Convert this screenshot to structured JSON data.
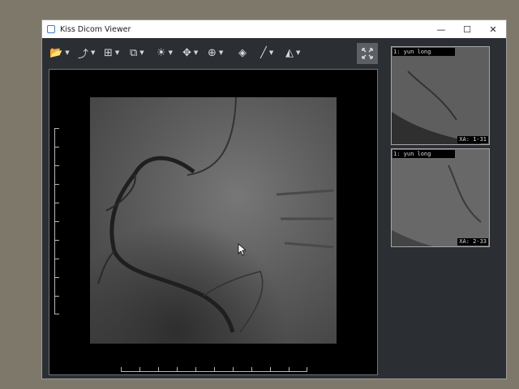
{
  "window": {
    "title": "Kiss Dicom Viewer",
    "controls": {
      "minimize": "—",
      "maximize": "☐",
      "close": "✕"
    }
  },
  "toolbar": {
    "tools": [
      {
        "name": "open-tool",
        "icon": "folder-icon",
        "glyph": "📂",
        "dropdown": true
      },
      {
        "name": "export-tool",
        "icon": "export-icon",
        "glyph": "⤴",
        "dropdown": true
      },
      {
        "name": "layout-tool",
        "icon": "grid-layout-icon",
        "glyph": "⊞",
        "dropdown": true
      },
      {
        "name": "annotation-tool",
        "icon": "text-overlay-icon",
        "glyph": "⧉",
        "dropdown": true
      },
      {
        "name": "brightness-tool",
        "icon": "brightness-icon",
        "glyph": "☀",
        "dropdown": true
      },
      {
        "name": "pan-tool",
        "icon": "move-icon",
        "glyph": "✥",
        "dropdown": true
      },
      {
        "name": "zoom-tool",
        "icon": "zoom-icon",
        "glyph": "⊕",
        "dropdown": true
      },
      {
        "name": "layers-tool",
        "icon": "layers-icon",
        "glyph": "◈",
        "dropdown": false
      },
      {
        "name": "measure-tool",
        "icon": "line-measure-icon",
        "glyph": "╱",
        "dropdown": true
      },
      {
        "name": "flip-tool",
        "icon": "flip-icon",
        "glyph": "◭",
        "dropdown": true
      }
    ],
    "fullscreen_icon": "fullscreen-icon"
  },
  "viewer": {
    "image_name": "coronary-angiogram-image"
  },
  "thumbnails": [
    {
      "top_label": "1: yun long",
      "bottom_label": "XA: 1-31"
    },
    {
      "top_label": "1: yun long",
      "bottom_label": "XA: 2-33"
    }
  ],
  "colors": {
    "desktop": "#7d7869",
    "window_bg": "#2b2f33",
    "viewer_bg": "#000000"
  }
}
